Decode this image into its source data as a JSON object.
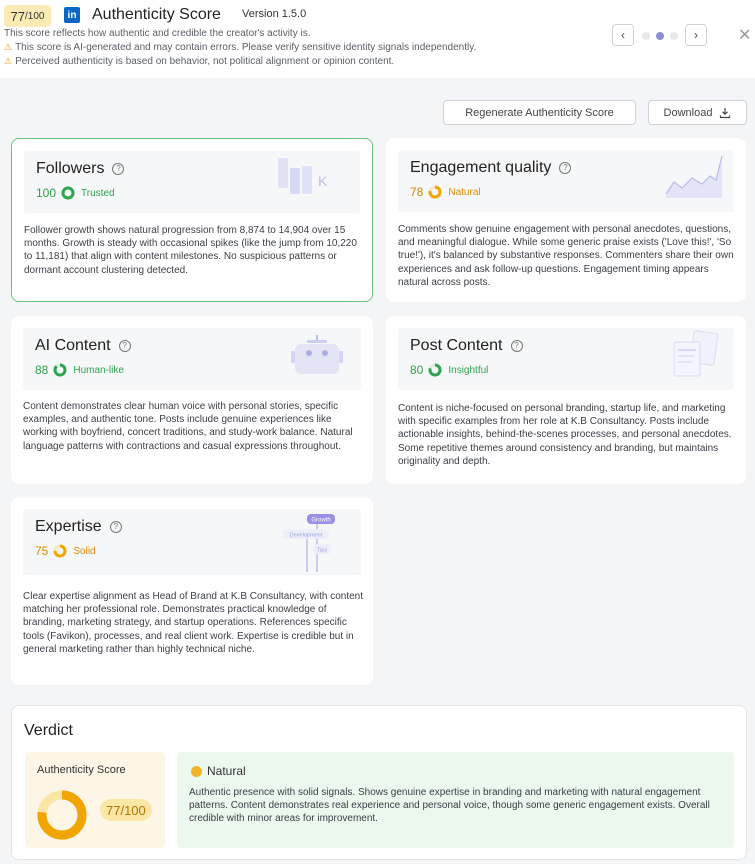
{
  "header": {
    "score_main": "77",
    "score_den": "/100",
    "logo_text": "in",
    "title": "Authenticity Score",
    "version": "Version 1.5.0",
    "description": "This score reflects how authentic and credible the creator's activity is.",
    "warning_1": "This score is AI-generated and may contain errors. Please verify sensitive identity signals independently.",
    "warning_2": "Perceived authenticity is based on behavior, not political alignment or opinion content.",
    "prev_glyph": "‹",
    "next_glyph": "›",
    "close_glyph": "✕",
    "warning_glyph": "⚠"
  },
  "actions": {
    "regenerate_label": "Regenerate Authenticity Score",
    "download_label": "Download"
  },
  "cards": {
    "followers": {
      "title": "Followers",
      "score": "100",
      "label": "Trusted",
      "score_fraction": 1.0,
      "illustration_letter": "K",
      "text": "Follower growth shows natural progression from 8,874 to 14,904 over 15 months. Growth is steady with occasional spikes (like the jump from 10,220 to 11,181) that align with content milestones. No suspicious patterns or dormant account clustering detected."
    },
    "engagement": {
      "title": "Engagement quality",
      "score": "78",
      "label": "Natural",
      "score_fraction": 0.78,
      "text": "Comments show genuine engagement with personal anecdotes, questions, and meaningful dialogue. While some generic praise exists ('Love this!', 'So true!'), it's balanced by substantive responses. Commenters share their own experiences and ask follow-up questions. Engagement timing appears natural across posts."
    },
    "ai_content": {
      "title": "AI Content",
      "score": "88",
      "label": "Human-like",
      "score_fraction": 0.88,
      "text": "Content demonstrates clear human voice with personal stories, specific examples, and authentic tone. Posts include genuine experiences like working with boyfriend, concert traditions, and study-work balance. Natural language patterns with contractions and casual expressions throughout."
    },
    "post_content": {
      "title": "Post Content",
      "score": "80",
      "label": "Insightful",
      "score_fraction": 0.8,
      "text": "Content is niche-focused on personal branding, startup life, and marketing with specific examples from her role at K.B Consultancy. Posts include actionable insights, behind-the-scenes processes, and personal anecdotes. Some repetitive themes around consistency and branding, but maintains originality and depth."
    },
    "expertise": {
      "title": "Expertise",
      "score": "75",
      "label": "Solid",
      "score_fraction": 0.75,
      "illus_growth": "Growth",
      "illus_development": "Development",
      "illus_tips": "Tips",
      "text": "Clear expertise alignment as Head of Brand at K.B Consultancy, with content matching her professional role. Demonstrates practical knowledge of branding, marketing strategy, and startup operations. References specific tools (Favikon), processes, and real client work. Expertise is credible but in general marketing rather than highly technical niche."
    }
  },
  "verdict": {
    "title": "Verdict",
    "auth_label": "Authenticity Score",
    "auth_score": "77/100",
    "score_fraction": 0.77,
    "natural_label": "Natural",
    "natural_text": "Authentic presence with solid signals. Shows genuine expertise in branding and marketing with natural engagement patterns. Content demonstrates real experience and personal voice, though some generic engagement exists. Overall credible with minor areas for improvement."
  },
  "colors": {
    "trusted": "#2da44e",
    "natural": "#e08a00",
    "human_like": "#2da44e",
    "insightful": "#2da44e",
    "solid": "#e08a00",
    "verdict_ring": "#f0a500"
  }
}
